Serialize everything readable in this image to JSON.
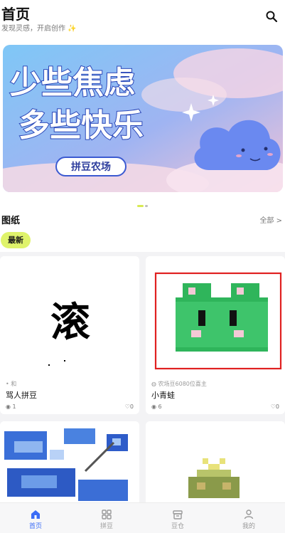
{
  "header": {
    "title": "首页",
    "subtitle": "发现灵感，开启创作 ✨"
  },
  "banner": {
    "line1": "少些焦虑",
    "line2": "多些快乐",
    "tag": "拼豆农场",
    "page_index": 1,
    "page_count": 2
  },
  "section": {
    "title": "图纸",
    "see_all": "全部 >",
    "chip": "最新"
  },
  "cards": [
    {
      "glyph": "滚",
      "author": "和",
      "name": "骂人拼豆",
      "views": "1",
      "likes": "0"
    },
    {
      "author": "农场豆6080位喜主",
      "name": "小青蛙",
      "views": "6",
      "likes": "0"
    }
  ],
  "tabs": [
    {
      "label": "首页",
      "active": true
    },
    {
      "label": "拼豆",
      "active": false
    },
    {
      "label": "豆仓",
      "active": false
    },
    {
      "label": "我的",
      "active": false
    }
  ],
  "colors": {
    "accent_chip": "#dff36b",
    "tab_active": "#3b6cf6",
    "frog_green": "#3ec46b",
    "highlight_border": "#e02020"
  }
}
